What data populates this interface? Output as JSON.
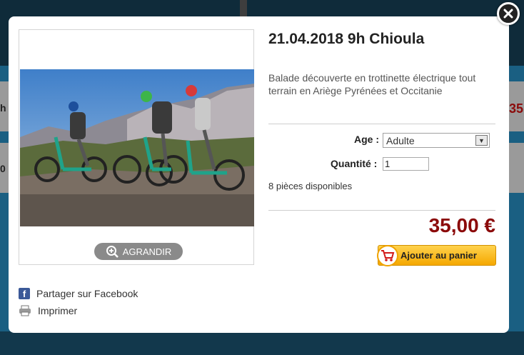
{
  "modal": {
    "close_icon": "close-icon",
    "title": "21.04.2018 9h Chioula",
    "description": "Balade découverte en trottinette électrique tout terrain en Ariège Pyrénées et Occitanie",
    "enlarge_label": "AGRANDIR",
    "share_facebook": "Partager sur Facebook",
    "print": "Imprimer",
    "age_label": "Age :",
    "age_value": "Adulte",
    "quantity_label": "Quantité :",
    "quantity_value": "1",
    "availability": "8 pièces disponibles",
    "price": "35,00 €",
    "add_to_cart": "Ajouter au panier"
  },
  "background": {
    "partial_left_h": "h",
    "partial_left_0": "0",
    "partial_right_price": "35"
  },
  "colors": {
    "price": "#8b0a0a",
    "cart_button": "#f5a800",
    "facebook": "#3b5998"
  }
}
